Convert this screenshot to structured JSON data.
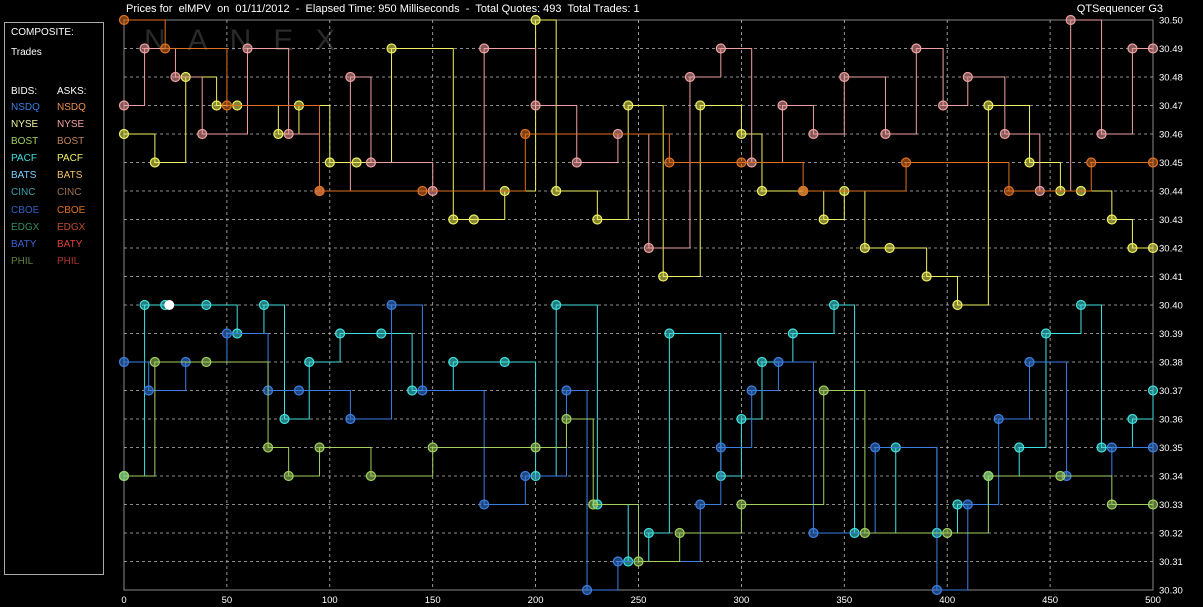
{
  "header": {
    "title": "Prices for  elMPV  on  01/11/2012  -  Elapsed Time: 950 Milliseconds  -  Total Quotes: 493  Total Trades: 1",
    "app_name": "QTSequencer G3"
  },
  "legend": {
    "composite_label": "COMPOSITE:",
    "trades_label": "Trades",
    "bids_label": "BIDS:",
    "asks_label": "ASKS:",
    "bids": [
      {
        "name": "NSDQ",
        "color": "#3b7fe3"
      },
      {
        "name": "NYSE",
        "color": "#f0f0a0"
      },
      {
        "name": "BOST",
        "color": "#a0d060"
      },
      {
        "name": "PACF",
        "color": "#40e0e0"
      },
      {
        "name": "BATS",
        "color": "#80d0ff"
      },
      {
        "name": "CINC",
        "color": "#3aa0b0"
      },
      {
        "name": "CBOE",
        "color": "#3060c0"
      },
      {
        "name": "EDGX",
        "color": "#309060"
      },
      {
        "name": "BATY",
        "color": "#4060d0"
      },
      {
        "name": "PHIL",
        "color": "#608040"
      }
    ],
    "asks": [
      {
        "name": "NSDQ",
        "color": "#f09050"
      },
      {
        "name": "NYSE",
        "color": "#f0a0a0"
      },
      {
        "name": "BOST",
        "color": "#c08060"
      },
      {
        "name": "PACF",
        "color": "#f0f060"
      },
      {
        "name": "BATS",
        "color": "#f0c070"
      },
      {
        "name": "CINC",
        "color": "#a07050"
      },
      {
        "name": "CBOE",
        "color": "#e07020"
      },
      {
        "name": "EDGX",
        "color": "#c05030"
      },
      {
        "name": "BATY",
        "color": "#e04040"
      },
      {
        "name": "PHIL",
        "color": "#b03030"
      }
    ]
  },
  "watermark": "NANEX",
  "chart_data": {
    "type": "line",
    "xlim": [
      0,
      500
    ],
    "ylim": [
      30.3,
      30.5
    ],
    "x_ticks": [
      "0",
      "50",
      "100",
      "150",
      "200",
      "250",
      "300",
      "350",
      "400",
      "450",
      "500"
    ],
    "y_ticks": [
      "30.30",
      "30.31",
      "30.32",
      "30.33",
      "30.34",
      "30.35",
      "30.36",
      "30.37",
      "30.38",
      "30.39",
      "30.40",
      "30.41",
      "30.42",
      "30.43",
      "30.44",
      "30.45",
      "30.46",
      "30.47",
      "30.48",
      "30.49",
      "30.50"
    ],
    "grid": true,
    "trades": [
      {
        "x": 22,
        "y": 30.4
      }
    ],
    "series": [
      {
        "color": "#f0f060",
        "points": [
          [
            0,
            30.46
          ],
          [
            15,
            30.45
          ],
          [
            30,
            30.48
          ],
          [
            45,
            30.47
          ],
          [
            55,
            30.47
          ],
          [
            75,
            30.46
          ],
          [
            85,
            30.47
          ],
          [
            100,
            30.45
          ],
          [
            113,
            30.45
          ],
          [
            130,
            30.49
          ],
          [
            160,
            30.43
          ],
          [
            170,
            30.43
          ],
          [
            185,
            30.44
          ],
          [
            200,
            30.5
          ],
          [
            210,
            30.44
          ],
          [
            230,
            30.43
          ],
          [
            245,
            30.47
          ],
          [
            262,
            30.41
          ],
          [
            280,
            30.47
          ],
          [
            300,
            30.46
          ],
          [
            310,
            30.44
          ],
          [
            330,
            30.44
          ],
          [
            340,
            30.43
          ],
          [
            350,
            30.44
          ],
          [
            360,
            30.42
          ],
          [
            372,
            30.42
          ],
          [
            390,
            30.41
          ],
          [
            405,
            30.4
          ],
          [
            420,
            30.47
          ],
          [
            440,
            30.45
          ],
          [
            455,
            30.44
          ],
          [
            465,
            30.44
          ],
          [
            480,
            30.43
          ],
          [
            490,
            30.42
          ],
          [
            500,
            30.42
          ]
        ]
      },
      {
        "color": "#f0a0a0",
        "points": [
          [
            0,
            30.47
          ],
          [
            10,
            30.49
          ],
          [
            25,
            30.48
          ],
          [
            38,
            30.46
          ],
          [
            60,
            30.49
          ],
          [
            80,
            30.46
          ],
          [
            95,
            30.44
          ],
          [
            110,
            30.48
          ],
          [
            120,
            30.45
          ],
          [
            150,
            30.44
          ],
          [
            175,
            30.49
          ],
          [
            200,
            30.47
          ],
          [
            220,
            30.45
          ],
          [
            240,
            30.46
          ],
          [
            255,
            30.42
          ],
          [
            275,
            30.48
          ],
          [
            290,
            30.49
          ],
          [
            305,
            30.45
          ],
          [
            320,
            30.47
          ],
          [
            335,
            30.46
          ],
          [
            350,
            30.48
          ],
          [
            370,
            30.46
          ],
          [
            385,
            30.49
          ],
          [
            398,
            30.47
          ],
          [
            410,
            30.48
          ],
          [
            428,
            30.46
          ],
          [
            445,
            30.44
          ],
          [
            460,
            30.5
          ],
          [
            475,
            30.46
          ],
          [
            490,
            30.49
          ],
          [
            500,
            30.49
          ]
        ]
      },
      {
        "color": "#e07020",
        "points": [
          [
            0,
            30.5
          ],
          [
            20,
            30.49
          ],
          [
            50,
            30.47
          ],
          [
            95,
            30.44
          ],
          [
            145,
            30.44
          ],
          [
            195,
            30.46
          ],
          [
            265,
            30.45
          ],
          [
            300,
            30.45
          ],
          [
            330,
            30.44
          ],
          [
            380,
            30.45
          ],
          [
            430,
            30.44
          ],
          [
            470,
            30.45
          ],
          [
            500,
            30.45
          ]
        ]
      },
      {
        "color": "#40e0e0",
        "points": [
          [
            0,
            30.34
          ],
          [
            10,
            30.4
          ],
          [
            20,
            30.4
          ],
          [
            40,
            30.4
          ],
          [
            55,
            30.39
          ],
          [
            68,
            30.4
          ],
          [
            78,
            30.36
          ],
          [
            90,
            30.38
          ],
          [
            105,
            30.39
          ],
          [
            125,
            30.39
          ],
          [
            140,
            30.37
          ],
          [
            160,
            30.38
          ],
          [
            185,
            30.38
          ],
          [
            200,
            30.34
          ],
          [
            210,
            30.4
          ],
          [
            230,
            30.33
          ],
          [
            245,
            30.31
          ],
          [
            255,
            30.32
          ],
          [
            265,
            30.39
          ],
          [
            290,
            30.34
          ],
          [
            300,
            30.36
          ],
          [
            310,
            30.38
          ],
          [
            325,
            30.39
          ],
          [
            345,
            30.4
          ],
          [
            355,
            30.32
          ],
          [
            375,
            30.35
          ],
          [
            395,
            30.32
          ],
          [
            405,
            30.33
          ],
          [
            420,
            30.34
          ],
          [
            435,
            30.35
          ],
          [
            448,
            30.39
          ],
          [
            465,
            30.4
          ],
          [
            475,
            30.35
          ],
          [
            490,
            30.36
          ],
          [
            500,
            30.37
          ]
        ]
      },
      {
        "color": "#3b7fe3",
        "points": [
          [
            0,
            30.38
          ],
          [
            12,
            30.37
          ],
          [
            30,
            30.38
          ],
          [
            50,
            30.39
          ],
          [
            70,
            30.37
          ],
          [
            85,
            30.37
          ],
          [
            110,
            30.36
          ],
          [
            130,
            30.4
          ],
          [
            145,
            30.37
          ],
          [
            175,
            30.33
          ],
          [
            195,
            30.34
          ],
          [
            215,
            30.37
          ],
          [
            225,
            30.3
          ],
          [
            240,
            30.31
          ],
          [
            280,
            30.33
          ],
          [
            290,
            30.35
          ],
          [
            305,
            30.37
          ],
          [
            318,
            30.38
          ],
          [
            335,
            30.32
          ],
          [
            365,
            30.35
          ],
          [
            395,
            30.3
          ],
          [
            410,
            30.33
          ],
          [
            425,
            30.36
          ],
          [
            440,
            30.38
          ],
          [
            458,
            30.34
          ],
          [
            480,
            30.35
          ],
          [
            500,
            30.35
          ]
        ]
      },
      {
        "color": "#a0d060",
        "points": [
          [
            0,
            30.34
          ],
          [
            15,
            30.38
          ],
          [
            40,
            30.38
          ],
          [
            70,
            30.35
          ],
          [
            80,
            30.34
          ],
          [
            95,
            30.35
          ],
          [
            120,
            30.34
          ],
          [
            150,
            30.35
          ],
          [
            200,
            30.35
          ],
          [
            215,
            30.36
          ],
          [
            228,
            30.33
          ],
          [
            250,
            30.31
          ],
          [
            270,
            30.32
          ],
          [
            300,
            30.33
          ],
          [
            340,
            30.37
          ],
          [
            360,
            30.32
          ],
          [
            400,
            30.32
          ],
          [
            420,
            30.34
          ],
          [
            455,
            30.34
          ],
          [
            480,
            30.33
          ],
          [
            500,
            30.33
          ]
        ]
      }
    ]
  }
}
